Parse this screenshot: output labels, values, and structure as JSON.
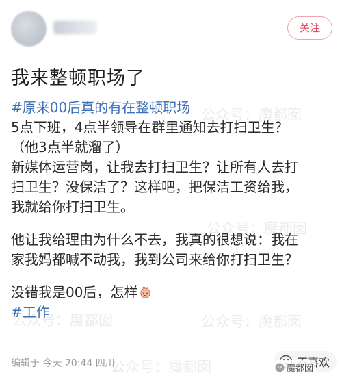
{
  "header": {
    "follow_label": "关注"
  },
  "post": {
    "title": "我来整顿职场了",
    "hashtag_top": "#原来00后真的有在整顿职场",
    "lines_a": [
      "5点下班，4点半领导在群里通知去打扫卫生？",
      "（他3点半就溜了）",
      "新媒体运营岗，让我去打扫卫生？让所有人去打",
      "扫卫生？没保洁了？这样吧，把保洁工资给我，",
      "我就给你打扫卫生。"
    ],
    "lines_b": [
      "他让我给理由为什么不去，我真的很想说：我在",
      "家我妈都喊不动我，我到公司来给你打扫卫生？"
    ],
    "line_c": "没错我是00后，怎样",
    "hashtag_bottom": "#工作"
  },
  "footer": {
    "meta": "编辑于 今天 20:44 四川",
    "dislike_label": "不喜欢"
  },
  "watermark": {
    "text": "公众号：魔都囡",
    "badge": "魔都囡"
  }
}
